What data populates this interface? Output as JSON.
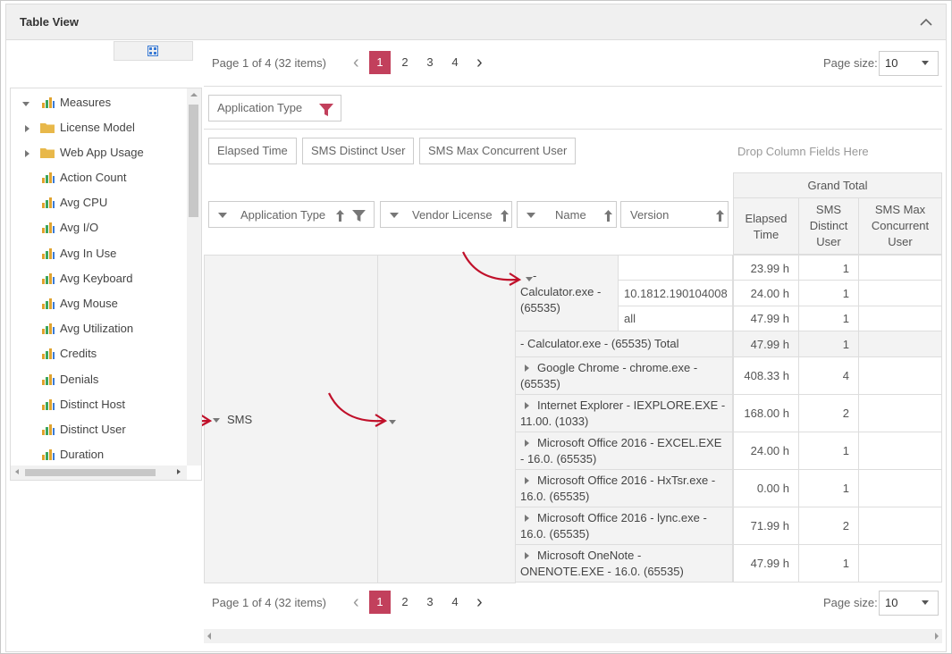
{
  "window": {
    "title": "Table View"
  },
  "pager_top": {
    "info": "Page 1 of 4 (32 items)",
    "pages": [
      "1",
      "2",
      "3",
      "4"
    ],
    "active_page": "1",
    "size_label": "Page size:",
    "size_value": "10"
  },
  "pager_bottom": {
    "info": "Page 1 of 4 (32 items)",
    "pages": [
      "1",
      "2",
      "3",
      "4"
    ],
    "active_page": "1",
    "size_label": "Page size:",
    "size_value": "10"
  },
  "filter_area": {
    "chip": "Application Type"
  },
  "data_area": {
    "chips": [
      "Elapsed Time",
      "SMS Distinct User",
      "SMS Max Concurrent User"
    ],
    "drop_hint": "Drop Column Fields Here"
  },
  "row_fields": [
    "Application Type",
    "Vendor License",
    "Name",
    "Version"
  ],
  "grand_total": "Grand Total",
  "columns": [
    "Elapsed Time",
    "SMS Distinct User",
    "SMS Max Concurrent User"
  ],
  "row_groups": {
    "application_type": "SMS"
  },
  "rows": {
    "calc_name": "- Calculator.exe - (65535)",
    "calc_versions": [
      {
        "version": "",
        "elapsed": "23.99 h",
        "distinct": "1",
        "max": ""
      },
      {
        "version": "10.1812.190104008",
        "elapsed": "24.00 h",
        "distinct": "1",
        "max": ""
      },
      {
        "version": "all",
        "elapsed": "47.99 h",
        "distinct": "1",
        "max": ""
      }
    ],
    "calc_total": {
      "label": "- Calculator.exe - (65535) Total",
      "elapsed": "47.99 h",
      "distinct": "1",
      "max": ""
    },
    "apps": [
      {
        "name": "Google Chrome - chrome.exe - (65535)",
        "elapsed": "408.33 h",
        "distinct": "4",
        "max": ""
      },
      {
        "name": "Internet Explorer - IEXPLORE.EXE - 11.00. (1033)",
        "elapsed": "168.00 h",
        "distinct": "2",
        "max": ""
      },
      {
        "name": "Microsoft Office 2016 - EXCEL.EXE - 16.0. (65535)",
        "elapsed": "24.00 h",
        "distinct": "1",
        "max": ""
      },
      {
        "name": "Microsoft Office 2016 - HxTsr.exe - 16.0. (65535)",
        "elapsed": "0.00 h",
        "distinct": "1",
        "max": ""
      },
      {
        "name": "Microsoft Office 2016 - lync.exe - 16.0. (65535)",
        "elapsed": "71.99 h",
        "distinct": "2",
        "max": ""
      },
      {
        "name": "Microsoft OneNote - ONENOTE.EXE - 16.0. (65535)",
        "elapsed": "47.99 h",
        "distinct": "1",
        "max": ""
      }
    ]
  },
  "tree": {
    "root": "Measures",
    "folders": [
      "License Model",
      "Web App Usage"
    ],
    "measures": [
      "Action Count",
      "Avg CPU",
      "Avg I/O",
      "Avg In Use",
      "Avg Keyboard",
      "Avg Mouse",
      "Avg Utilization",
      "Credits",
      "Denials",
      "Distinct Host",
      "Distinct User",
      "Duration"
    ]
  },
  "icons": {
    "collapse": "chevron-up-icon",
    "field-list": "grid-icon",
    "filter": "filter-icon",
    "sort": "sort-arrow-icon",
    "annotation": "curved-arrow-icon"
  },
  "colors": {
    "accent": "#c2405c",
    "annotation": "#c0102a",
    "header_bg": "#f3f3f3",
    "title_bg": "#f0f0f0"
  }
}
